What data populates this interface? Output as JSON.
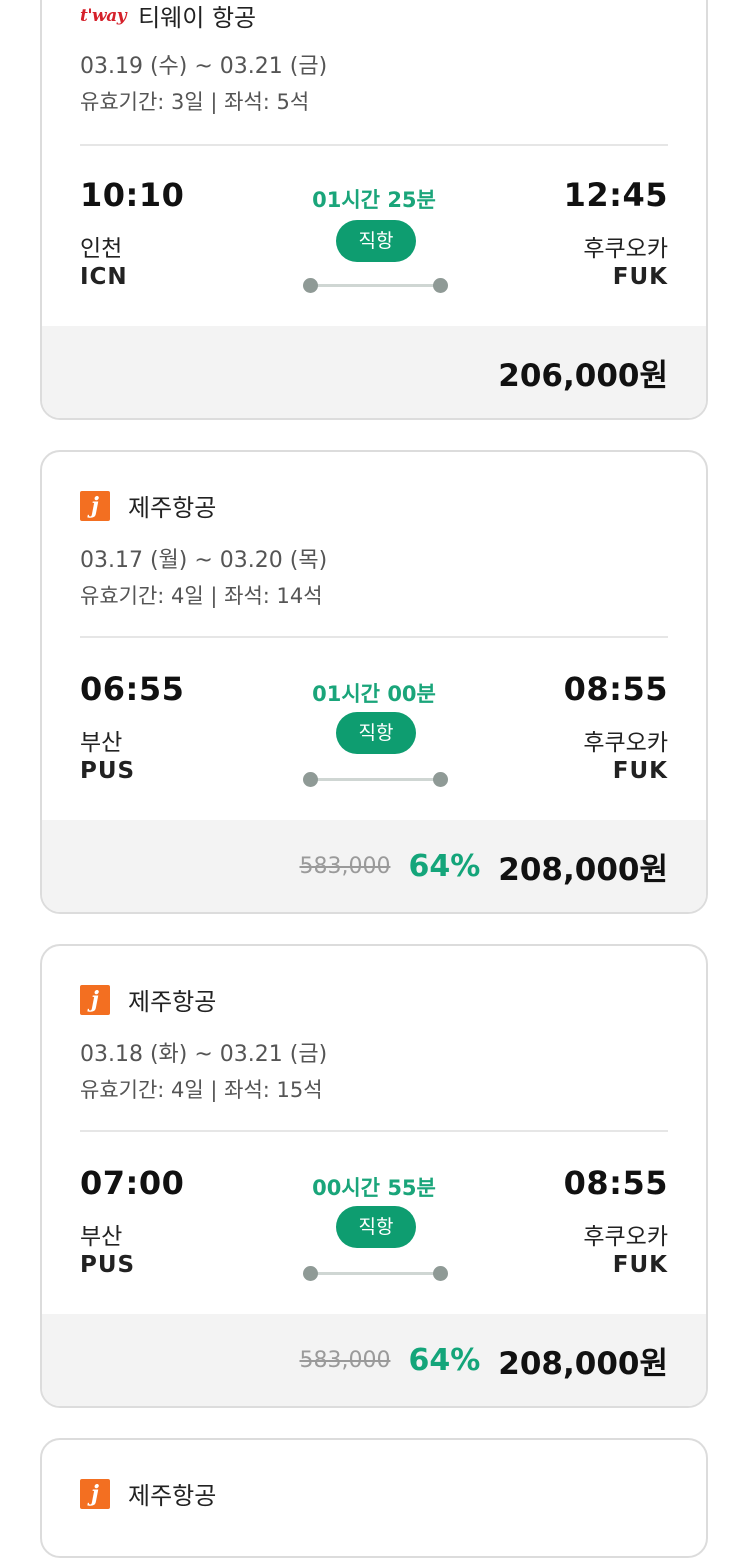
{
  "cards": [
    {
      "airline": "티웨이 항공",
      "logo_text": "t'way",
      "logo_icon": "tway-logo-icon",
      "dates": "03.19 (수) ~ 03.21 (금)",
      "meta": "유효기간: 3일 | 좌석: 5석",
      "dep_time": "10:10",
      "dep_city": "인천",
      "dep_code": "ICN",
      "duration": "01시간 25분",
      "direct": "직항",
      "arr_time": "12:45",
      "arr_city": "후쿠오카",
      "arr_code": "FUK",
      "orig_price": "",
      "discount": "",
      "price": "206,000원"
    },
    {
      "airline": "제주항공",
      "logo_text": "j",
      "logo_icon": "jeju-air-logo-icon",
      "dates": "03.17 (월) ~ 03.20 (목)",
      "meta": "유효기간: 4일 | 좌석: 14석",
      "dep_time": "06:55",
      "dep_city": "부산",
      "dep_code": "PUS",
      "duration": "01시간 00분",
      "direct": "직항",
      "arr_time": "08:55",
      "arr_city": "후쿠오카",
      "arr_code": "FUK",
      "orig_price": "583,000",
      "discount": "64%",
      "price": "208,000원"
    },
    {
      "airline": "제주항공",
      "logo_text": "j",
      "logo_icon": "jeju-air-logo-icon",
      "dates": "03.18 (화) ~ 03.21 (금)",
      "meta": "유효기간: 4일 | 좌석: 15석",
      "dep_time": "07:00",
      "dep_city": "부산",
      "dep_code": "PUS",
      "duration": "00시간 55분",
      "direct": "직항",
      "arr_time": "08:55",
      "arr_city": "후쿠오카",
      "arr_code": "FUK",
      "orig_price": "583,000",
      "discount": "64%",
      "price": "208,000원"
    },
    {
      "airline": "제주항공",
      "logo_text": "j",
      "logo_icon": "jeju-air-logo-icon"
    }
  ],
  "colors": {
    "accent_green": "#0e9d70",
    "duration_green": "#1aa57a",
    "tway_red": "#d5202a",
    "jeju_orange": "#f36f21"
  }
}
